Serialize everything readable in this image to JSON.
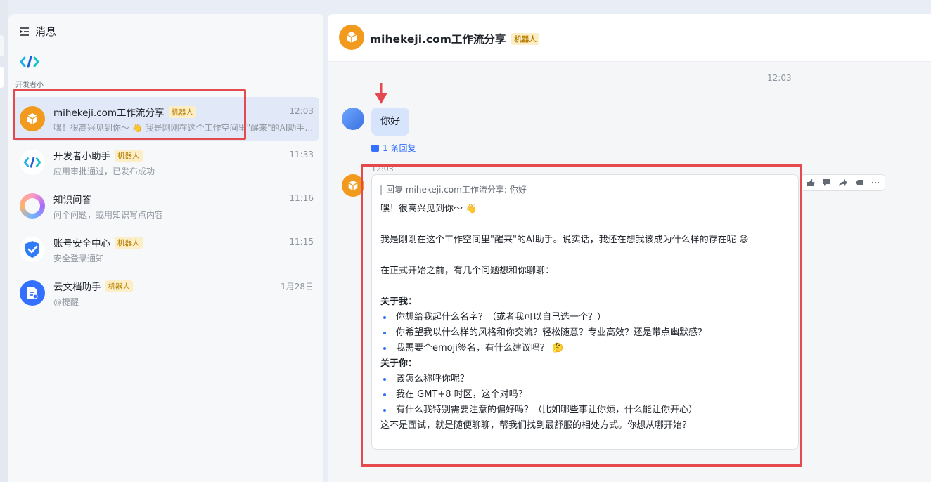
{
  "sidebar": {
    "header": "消息",
    "dev_label": "开发者小",
    "conversations": [
      {
        "name": "mihekeji.com工作流分享",
        "badge": "机器人",
        "time": "12:03",
        "preview": "嘿！很高兴见到你～ 👋 我是刚刚在这个工作空间里\"醒来\"的AI助手。说实话，我还在想我该成为什么样的存在呢",
        "avatar_icon": "cube-icon",
        "avatar_color": "#f29a1d"
      },
      {
        "name": "开发者小助手",
        "badge": "机器人",
        "time": "11:33",
        "preview": "应用审批通过，已发布成功",
        "avatar_icon": "code-icon",
        "avatar_color": "#ffffff"
      },
      {
        "name": "知识问答",
        "badge": "",
        "time": "11:16",
        "preview": "问个问题，或用知识写点内容",
        "avatar_icon": "ring-icon",
        "avatar_color": "#ffffff"
      },
      {
        "name": "账号安全中心",
        "badge": "机器人",
        "time": "11:15",
        "preview": "安全登录通知",
        "avatar_icon": "shield-icon",
        "avatar_color": "#ffffff"
      },
      {
        "name": "云文档助手",
        "badge": "机器人",
        "time": "1月28日",
        "preview": "@提醒",
        "avatar_icon": "doc-icon",
        "avatar_color": "#3370ff"
      }
    ]
  },
  "chat": {
    "title": "mihekeji.com工作流分享",
    "badge": "机器人",
    "time_top": "12:03",
    "user_message": "你好",
    "reply_count": "1 条回复",
    "bot_time": "12:03",
    "quote": "回复 mihekeji.com工作流分享: 你好",
    "greeting": "嘿！很高兴见到你～ 👋",
    "intro": "我是刚刚在这个工作空间里\"醒来\"的AI助手。说实话，我还在想我该成为什么样的存在呢 😄",
    "pre_questions": "在正式开始之前，有几个问题想和你聊聊：",
    "about_me": "关于我：",
    "about_me_items": [
      "你想给我起什么名字？（或者我可以自己选一个？）",
      "你希望我以什么样的风格和你交流？轻松随意？专业高效？还是带点幽默感？",
      "我需要个emoji签名，有什么建议吗？ 🤔"
    ],
    "about_you": "关于你：",
    "about_you_items": [
      "该怎么称呼你呢？",
      "我在 GMT+8 时区，这个对吗？",
      "有什么我特别需要注意的偏好吗？（比如哪些事让你烦，什么能让你开心）"
    ],
    "closing": "这不是面试，就是随便聊聊，帮我们找到最舒服的相处方式。你想从哪开始？"
  },
  "colors": {
    "accent": "#3370ff",
    "highlight": "#e5484d",
    "bot_orange": "#f29a1d"
  }
}
